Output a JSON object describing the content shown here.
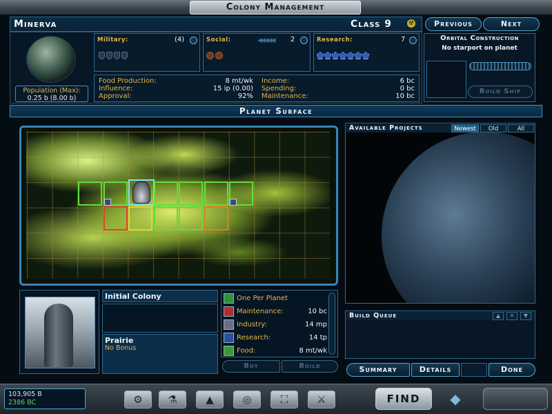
{
  "window": {
    "title": "Colony Management"
  },
  "colony": {
    "name": "Minerva",
    "class_label": "Class 9",
    "population_label": "Population (Max):",
    "population_value": "0.25 b (8.00 b)"
  },
  "nav": {
    "previous": "Previous",
    "next": "Next"
  },
  "stats": {
    "military": {
      "label": "Military:",
      "value": "(4)"
    },
    "social": {
      "label": "Social:",
      "value": "2"
    },
    "research": {
      "label": "Research:",
      "value": "7"
    }
  },
  "economy": {
    "food_label": "Food Production:",
    "food_value": "8 mt/wk",
    "influence_label": "Influence:",
    "influence_value": "15 ip (0.00)",
    "approval_label": "Approval:",
    "approval_value": "92%",
    "income_label": "Income:",
    "income_value": "6 bc",
    "spending_label": "Spending:",
    "spending_value": "0 bc",
    "maintenance_label": "Maintenance:",
    "maintenance_value": "10 bc"
  },
  "orbital": {
    "title": "Orbital Construction",
    "message": "No starport on planet",
    "build_ship": "Build Ship"
  },
  "surface": {
    "title": "Planet Surface"
  },
  "projects": {
    "title": "Available Projects",
    "filters": {
      "newest": "Newest",
      "old": "Old",
      "all": "All"
    }
  },
  "queue": {
    "title": "Build Queue"
  },
  "actions": {
    "summary": "Summary",
    "details": "Details",
    "done": "Done",
    "buy": "Buy",
    "build": "Build"
  },
  "improvement": {
    "name": "Initial Colony",
    "terrain": "Prairie",
    "terrain_bonus": "No Bonus",
    "props": {
      "per_planet": "One Per Planet",
      "maintenance_label": "Maintenance:",
      "maintenance_value": "10 bc",
      "industry_label": "Industry:",
      "industry_value": "14 mp",
      "research_label": "Research:",
      "research_value": "14 tp",
      "food_label": "Food:",
      "food_value": "8 mt/wk"
    }
  },
  "treasury": {
    "top": "103,905 B",
    "bottom": "2386 BC"
  },
  "toolbar": {
    "find": "FIND"
  },
  "colors": {
    "accent": "#4c8fb5",
    "label": "#e7b64a",
    "panel": "#081b2b"
  }
}
